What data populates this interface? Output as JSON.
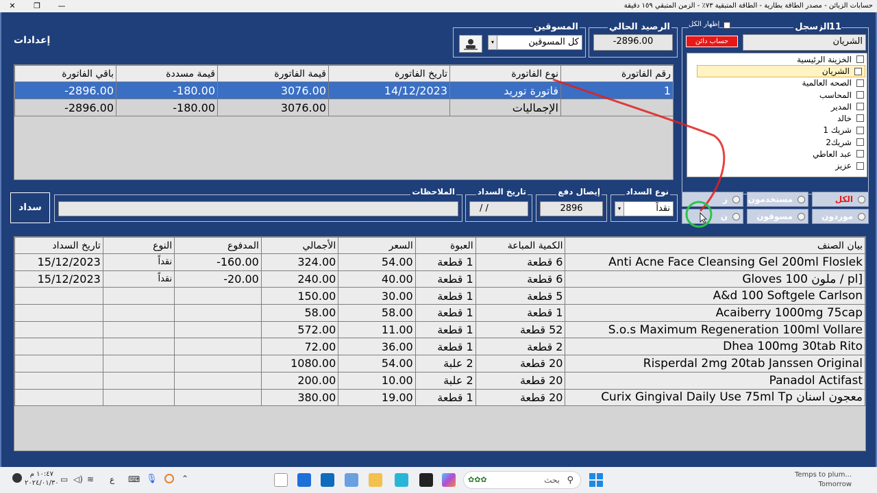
{
  "window": {
    "title": "حسابات الزبائن - مصدر الطاقة بطارية - الطاقة المتبقية ٧٣٪ - الزمن المتبقي ١٥٩ دقيقة",
    "controls": [
      "—",
      "❐",
      "✕"
    ]
  },
  "header": {
    "settings": "إعدادات",
    "customers_label": "الزبائن",
    "customers_count": "11",
    "records_label": "سجل",
    "show_all": "إظهار الكل",
    "customer_name": "الشريان",
    "account_status": "حساب دائن",
    "balance_label": "الرصيد الحالي",
    "balance_value": "-2896.00",
    "marketers_label": "المسوقين",
    "marketers_value": "كل المسوقين"
  },
  "tree": [
    {
      "label": "الخزينة الرئيسية"
    },
    {
      "label": "الشريان"
    },
    {
      "label": "الصحه العالمية"
    },
    {
      "label": "المحاسب"
    },
    {
      "label": "المدير"
    },
    {
      "label": "خالد"
    },
    {
      "label": "شريك 1"
    },
    {
      "label": "شريك2"
    },
    {
      "label": "عبد العاطي"
    },
    {
      "label": "عزيز"
    }
  ],
  "invoices": {
    "headers": [
      "رقم الفاتورة",
      "نوع الفاتورة",
      "تاريخ الفاتورة",
      "قيمة الفاتورة",
      "قيمة مسددة",
      "باقي الفاتورة"
    ],
    "rows": [
      [
        "1",
        "فاتورة توريد",
        "14/12/2023",
        "3076.00",
        "-180.00",
        "-2896.00"
      ],
      [
        "",
        "الإجماليات",
        "",
        "3076.00",
        "-180.00",
        "-2896.00"
      ]
    ]
  },
  "payment": {
    "pay_button": "سداد",
    "notes_label": "الملاحظات",
    "date_label": "تاريخ السداد",
    "date_value": "/  /",
    "receipt_label": "إيصال دفع",
    "receipt_value": "2896",
    "type_label": "نوع السداد",
    "type_value": "نقداً"
  },
  "filters": {
    "all": "الكل",
    "users": "مستخدمون",
    "customers_short": "ز",
    "suppliers": "موردون",
    "marketers": "مسوقون",
    "other_short": "ن"
  },
  "items": {
    "headers": [
      "بيان الصنف",
      "الكمية المباعة",
      "العبوة",
      "السعر",
      "الأجمالي",
      "المدفوع",
      "النوع",
      "تاريخ السداد"
    ],
    "rows": [
      [
        "Anti Acne Face Cleansing Gel 200ml  Floslek",
        "6 قطعة",
        "1 قطعة",
        "54.00",
        "324.00",
        "-160.00",
        "نقداً",
        "15/12/2023"
      ],
      [
        "Gloves ملون 100 / pl]",
        "6 قطعة",
        "1 قطعة",
        "40.00",
        "240.00",
        "-20.00",
        "نقداً",
        "15/12/2023"
      ],
      [
        "A&d 100 Softgele Carlson",
        "5 قطعة",
        "1 قطعة",
        "30.00",
        "150.00",
        "",
        "",
        ""
      ],
      [
        "Acaiberry 1000mg 75cap",
        "1 قطعة",
        "1 قطعة",
        "58.00",
        "58.00",
        "",
        "",
        ""
      ],
      [
        "S.o.s Maximum Regeneration 100ml Vollare",
        "52 قطعة",
        "1 قطعة",
        "11.00",
        "572.00",
        "",
        "",
        ""
      ],
      [
        "Dhea 100mg 30tab Rito",
        "2 قطعة",
        "1 قطعة",
        "36.00",
        "72.00",
        "",
        "",
        ""
      ],
      [
        "Risperdal 2mg 20tab Janssen Original",
        "20 قطعة",
        "2 علبة",
        "54.00",
        "1080.00",
        "",
        "",
        ""
      ],
      [
        "Panadol  Actifast",
        "20 قطعة",
        "2 علبة",
        "10.00",
        "200.00",
        "",
        "",
        ""
      ],
      [
        "Curix Gingival Daily Use 75ml Tp معجون اسنان",
        "20 قطعة",
        "1 قطعة",
        "19.00",
        "380.00",
        "",
        "",
        ""
      ]
    ]
  },
  "taskbar": {
    "time": "١٠:٤٧ م",
    "date": "٢٠٢٤/٠١/٣٠",
    "lang": "ع",
    "search_placeholder": "بحث",
    "weather_line1": "Temps to plum...",
    "weather_line2": "Tomorrow"
  },
  "colors": {
    "background": "#1f3f7a",
    "selection": "#3a6fc4",
    "alert": "#e81818",
    "annotation": "#e02020"
  }
}
